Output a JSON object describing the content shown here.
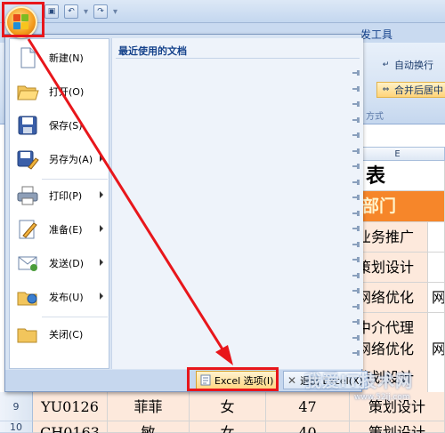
{
  "window": {
    "ribbon_tab": "发工具",
    "ribbon": {
      "wrap_text": "自动换行",
      "merge_center": "合并后居中",
      "group_label": "方式"
    }
  },
  "sheet": {
    "column_header": "E",
    "title_fragment": "表",
    "dept_header": "部门",
    "dept_values": [
      "业务推广",
      "策划设计",
      "网络优化",
      "中介代理",
      "网络优化",
      "策划设计"
    ],
    "col_e_values": [
      "",
      "",
      "网",
      "",
      "网",
      ""
    ],
    "row9": {
      "num": "9",
      "id": "YU0126",
      "name": "菲菲",
      "gender": "女",
      "age": "47",
      "dept": "策划设计"
    },
    "row10": {
      "num": "10",
      "id": "CH0163",
      "name": "敏",
      "gender": "女",
      "age": "40",
      "dept": "策划设计"
    }
  },
  "office_menu": {
    "items": [
      {
        "label": "新建(N)",
        "icon": "new-document-icon",
        "submenu": false
      },
      {
        "label": "打开(O)",
        "icon": "open-folder-icon",
        "submenu": false
      },
      {
        "label": "保存(S)",
        "icon": "save-disk-icon",
        "submenu": false
      },
      {
        "label": "另存为(A)",
        "icon": "save-as-icon",
        "submenu": true
      },
      {
        "label": "打印(P)",
        "icon": "printer-icon",
        "submenu": true
      },
      {
        "label": "准备(E)",
        "icon": "prepare-icon",
        "submenu": true
      },
      {
        "label": "发送(D)",
        "icon": "send-icon",
        "submenu": true
      },
      {
        "label": "发布(U)",
        "icon": "publish-icon",
        "submenu": true
      },
      {
        "label": "关闭(C)",
        "icon": "close-folder-icon",
        "submenu": false
      }
    ],
    "recent_title": "最近使用的文档",
    "recent_pin_count": 19,
    "options_button": "Excel 选项(I)",
    "exit_button": "退出 Excel(X)"
  },
  "watermark": {
    "text": "我爱IT技术网",
    "sub": "www.52ij.com"
  },
  "annotation_color": "#e8161b"
}
